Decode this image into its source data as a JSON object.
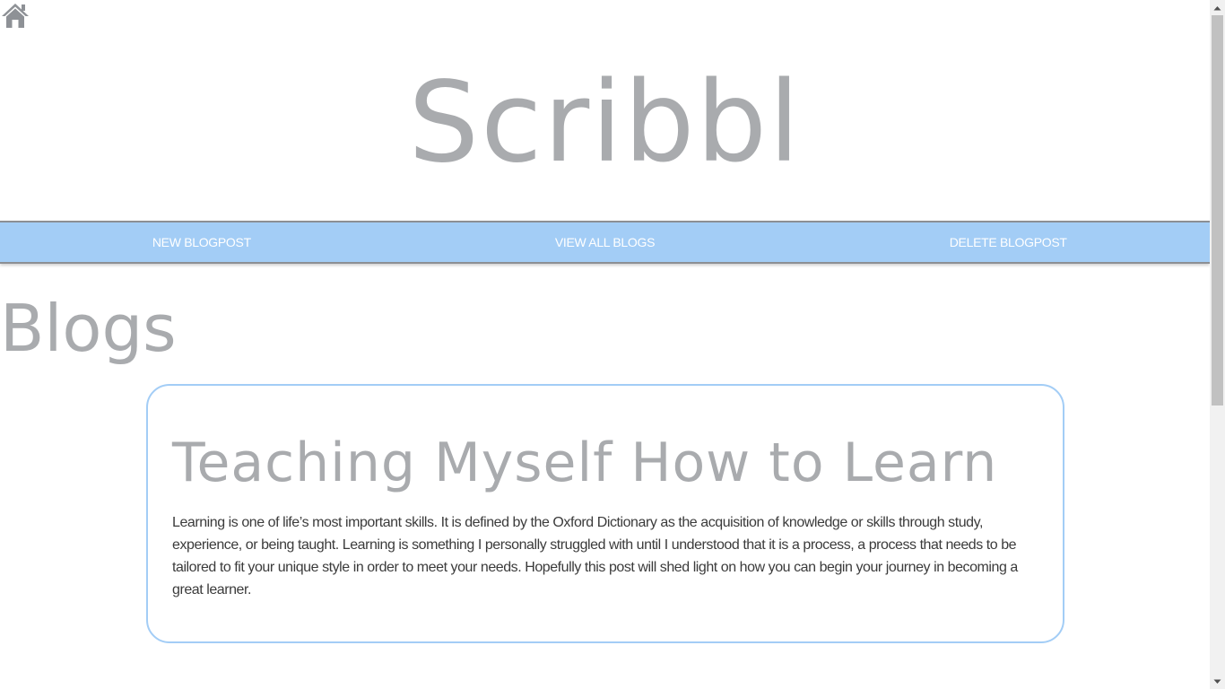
{
  "header": {
    "home_icon": "home-icon",
    "site_title": "Scribbl"
  },
  "nav": {
    "items": [
      {
        "label": "NEW BLOGPOST"
      },
      {
        "label": "VIEW ALL BLOGS"
      },
      {
        "label": "DELETE BLOGPOST"
      }
    ],
    "background_color": "#a3cdf6"
  },
  "main": {
    "section_heading": "Blogs",
    "posts": [
      {
        "title": "Teaching Myself How to Learn",
        "excerpt": "Learning is one of life’s most important skills. It is defined by the Oxford Dictionary as the acquisition of knowledge or skills through study, experience, or being taught. Learning is something I personally struggled with until I understood that it is a process, a process that needs to be tailored to fit your unique style in order to meet your needs. Hopefully this post will shed light on how you can begin your journey in becoming a great learner."
      }
    ]
  },
  "colors": {
    "title_gray": "#a9abae",
    "accent_blue": "#a3cdf6",
    "body_text": "#3b3b3b"
  }
}
